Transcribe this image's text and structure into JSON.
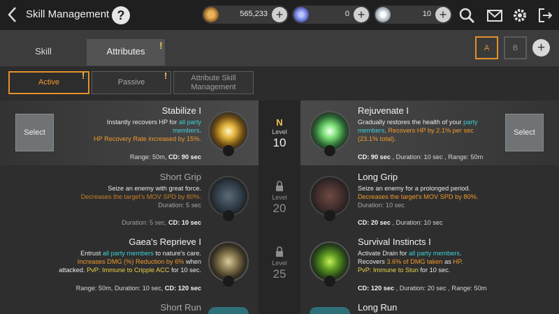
{
  "header": {
    "title": "Skill Management",
    "help_label": "?",
    "currencies": [
      {
        "icon": "gold-coin-icon",
        "value": "565,233"
      },
      {
        "icon": "blue-crystal-icon",
        "value": "0"
      },
      {
        "icon": "white-diamond-icon",
        "value": "10"
      }
    ],
    "icons": [
      "search-icon",
      "mail-icon",
      "gear-icon",
      "exit-icon"
    ]
  },
  "tabs": {
    "skill_label": "Skill",
    "attributes_label": "Attributes",
    "alert_mark": "!",
    "preset_a": "A",
    "preset_b": "B",
    "add_label": "+"
  },
  "subtabs": {
    "active": "Active",
    "passive": "Passive",
    "attr_line1": "Attribute Skill",
    "attr_line2": "Management"
  },
  "rows": [
    {
      "level_marker": "N",
      "level_label": "Level",
      "level": "10",
      "left": {
        "name": "Stabilize I",
        "desc1a": "Instantly recovers HP for ",
        "desc1b": "all party",
        "desc2": "members",
        "desc2end": ".",
        "desc3": "HP Recovery Rate increased by 15%.",
        "stats_pre": "Range: 50m, ",
        "stats_cd": "CD: 90 sec",
        "select_label": "Select"
      },
      "right": {
        "name": "Rejuvenate I",
        "desc1a": "Gradually restores the health of your ",
        "desc1b": "party",
        "desc2a": "members",
        "desc2b": ". ",
        "desc2c": "Recovers HP by 2.1% per sec",
        "desc3": "(23.1% total).",
        "stats_cd": "CD: 90 sec",
        "stats_post": " , Duration: 10 sec , Range: 50m",
        "select_label": "Select"
      }
    },
    {
      "level_label": "Level",
      "level": "20",
      "left": {
        "name": "Short Grip",
        "desc1": "Seize an enemy with great force.",
        "desc2": "Decreases the target's MOV SPD by 80%.",
        "desc3": "Duration: 5 sec",
        "stats_pre": "Duration: 5 sec, ",
        "stats_cd": "CD: 10 sec"
      },
      "right": {
        "name": "Long Grip",
        "desc1": "Seize an enemy for a prolonged period.",
        "desc2": "Decreases the target's MOV SPD by 80%.",
        "desc3": "Duration: 10 sec",
        "stats_cd": "CD: 20 sec",
        "stats_post": " , Duration: 10 sec"
      }
    },
    {
      "level_label": "Level",
      "level": "25",
      "left": {
        "name": "Gaea's Reprieve I",
        "desc1a": "Entrust ",
        "desc1b": "all party members",
        "desc1c": " to nature's care.",
        "desc2": "Increases DMG (%) Reduction by 6%",
        "desc2b": " when",
        "desc3a": "attacked. ",
        "desc3b": "PvP: Immune to Cripple ACC",
        "desc3c": " for 10 sec.",
        "stats_pre": "Range: 50m, Duration: 10 sec, ",
        "stats_cd": "CD: 120 sec"
      },
      "right": {
        "name": "Survival Instincts I",
        "desc1a": "Activate Drain for ",
        "desc1b": "all party members",
        "desc1c": ".",
        "desc2a": "Recovers ",
        "desc2b": "3.6% of DMG taken",
        "desc2c": " as ",
        "desc2d": "HP",
        "desc2e": ".",
        "desc3a": "PvP: Immune to Stun",
        "desc3b": " for 10 sec.",
        "stats_cd": "CD: 120 sec",
        "stats_post": " , Duration: 20 sec , Range: 50m"
      }
    },
    {
      "left": {
        "name": "Short Run"
      },
      "right": {
        "name": "Long Run"
      }
    }
  ],
  "colors": {
    "accent_orange": "#e2912b",
    "party_cyan": "#3ed0d8",
    "pvp_yellow": "#ecd24a"
  }
}
